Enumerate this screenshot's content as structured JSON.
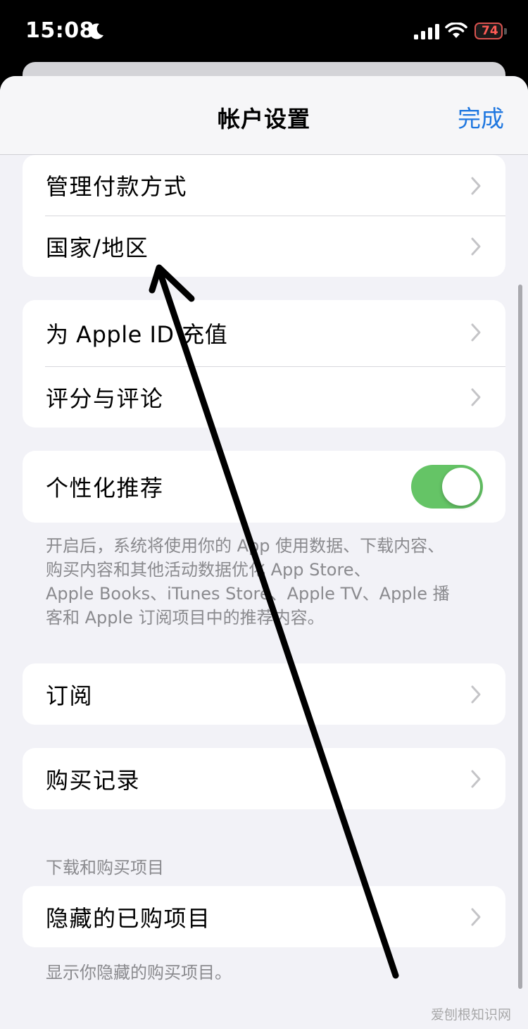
{
  "status_bar": {
    "time": "15:08",
    "battery": "74"
  },
  "nav": {
    "title": "帐户设置",
    "done_label": "完成"
  },
  "groups": {
    "payment": [
      {
        "label": "管理付款方式"
      },
      {
        "label": "国家/地区"
      }
    ],
    "apple_id": [
      {
        "label": "为 Apple ID 充值"
      },
      {
        "label": "评分与评论"
      }
    ],
    "personalized": {
      "label": "个性化推荐",
      "toggle_on": true,
      "footnote": [
        "开启后，系统将使用你的 App 使用数据、下载内容、",
        "购买内容和其他活动数据优化 App Store、",
        "Apple Books、iTunes Store、Apple TV、Apple 播",
        "客和 Apple 订阅项目中的推荐内容。"
      ]
    },
    "subscriptions": {
      "label": "订阅"
    },
    "purchase_history": {
      "label": "购买记录"
    },
    "downloads": {
      "header": "下载和购买项目",
      "label": "隐藏的已购项目",
      "footnote": "显示你隐藏的购买项目。"
    }
  },
  "watermark": "爱刨根知识网",
  "colors": {
    "accent": "#1f77e0",
    "toggle_on": "#65c466",
    "background": "#f2f2f7"
  },
  "icons": [
    "moon-icon",
    "signal-icon",
    "wifi-icon",
    "chevron-right-icon",
    "annotation-arrow-icon"
  ]
}
